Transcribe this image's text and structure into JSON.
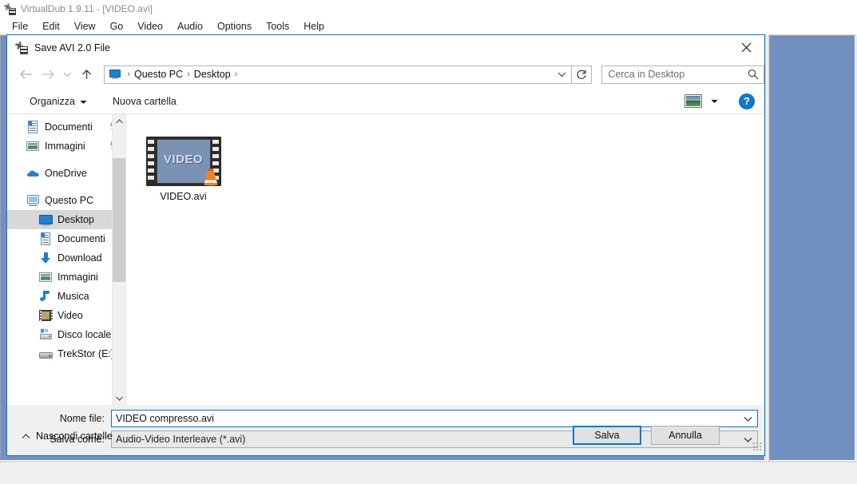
{
  "vdub": {
    "title": "VirtualDub 1.9.11 - [VIDEO.avi]",
    "app_icon": "virtualdub-icon",
    "menu": [
      {
        "label": "File"
      },
      {
        "label": "Edit"
      },
      {
        "label": "View"
      },
      {
        "label": "Go"
      },
      {
        "label": "Video"
      },
      {
        "label": "Audio"
      },
      {
        "label": "Options"
      },
      {
        "label": "Tools"
      },
      {
        "label": "Help"
      }
    ],
    "pane_color": "#7190c0"
  },
  "dialog": {
    "title": "Save AVI 2.0 File",
    "icon": "virtualdub-icon",
    "close_icon": "close-icon",
    "accent_color": "#0078d7",
    "nav": {
      "back_icon": "arrow-left-icon",
      "forward_icon": "arrow-right-icon",
      "recent_icon": "chevron-down-icon",
      "up_icon": "arrow-up-icon",
      "breadcrumbs": [
        {
          "label": "Questo PC"
        },
        {
          "label": "Desktop"
        }
      ],
      "breadcrumb_icon": "this-pc-icon",
      "separator": "›",
      "address_dropdown_icon": "chevron-down-icon",
      "refresh_icon": "refresh-icon",
      "search_placeholder": "Cerca in Desktop",
      "search_icon": "search-icon"
    },
    "command_bar": {
      "organizza_label": "Organizza",
      "organizza_icon": "chevron-down-icon",
      "nuova_cartella_label": "Nuova cartella",
      "view_icon": "view-layout-icon",
      "view_dropdown_icon": "chevron-down-icon",
      "help_label": "?",
      "help_icon": "help-icon"
    },
    "nav_pane": {
      "items": [
        {
          "label": "Documenti",
          "icon": "document-icon",
          "indent": 0,
          "pinned": true,
          "selected": false
        },
        {
          "label": "Immagini",
          "icon": "picture-icon",
          "indent": 0,
          "pinned": true,
          "selected": false
        },
        {
          "label": "OneDrive",
          "icon": "cloud-icon",
          "indent": 0,
          "pinned": false,
          "selected": false
        },
        {
          "label": "Questo PC",
          "icon": "monitor-icon",
          "indent": 0,
          "pinned": false,
          "selected": false
        },
        {
          "label": "Desktop",
          "icon": "desktop-icon",
          "indent": 1,
          "pinned": false,
          "selected": true
        },
        {
          "label": "Documenti",
          "icon": "document-icon",
          "indent": 1,
          "pinned": false,
          "selected": false
        },
        {
          "label": "Download",
          "icon": "download-icon",
          "indent": 1,
          "pinned": false,
          "selected": false
        },
        {
          "label": "Immagini",
          "icon": "picture-icon",
          "indent": 1,
          "pinned": false,
          "selected": false
        },
        {
          "label": "Musica",
          "icon": "music-icon",
          "indent": 1,
          "pinned": false,
          "selected": false
        },
        {
          "label": "Video",
          "icon": "video-icon",
          "indent": 1,
          "pinned": false,
          "selected": false
        },
        {
          "label": "Disco locale (C:)",
          "icon": "disk-icon",
          "indent": 1,
          "pinned": false,
          "selected": false
        },
        {
          "label": "TrekStor (E:)",
          "icon": "drive-icon",
          "indent": 1,
          "pinned": false,
          "selected": false
        }
      ],
      "scroll_up_icon": "chevron-up-icon",
      "scroll_down_icon": "chevron-down-icon"
    },
    "files": [
      {
        "name": "VIDEO.avi",
        "thumb_text": "VIDEO",
        "overlay_icon": "vlc-cone-icon"
      }
    ],
    "fields": {
      "nome_file_label": "Nome file:",
      "nome_file_value": "VIDEO compresso.avi",
      "salva_come_label": "Salva come:",
      "salva_come_value": "Audio-Video Interleave (*.avi)",
      "dropdown_icon": "chevron-down-icon"
    },
    "footer": {
      "hide_folders_label": "Nascondi cartelle",
      "hide_folders_icon": "chevron-up-icon",
      "save_label": "Salva",
      "cancel_label": "Annulla",
      "resize_grip": "resize-grip-icon"
    }
  }
}
